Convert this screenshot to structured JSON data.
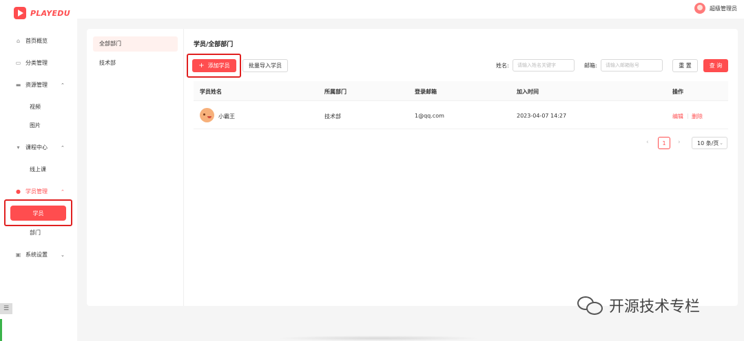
{
  "app": {
    "logo_text": "PLAYEDU"
  },
  "header": {
    "user_name": "超级管理员"
  },
  "sidebar": {
    "items": [
      {
        "label": "首页概览",
        "icon": "home-icon"
      },
      {
        "label": "分类管理",
        "icon": "category-icon"
      },
      {
        "label": "资源管理",
        "icon": "resource-icon",
        "expanded": true,
        "children": [
          "视频",
          "图片"
        ]
      },
      {
        "label": "课程中心",
        "icon": "course-icon",
        "expanded": true,
        "children": [
          "线上课"
        ]
      },
      {
        "label": "学员管理",
        "icon": "user-icon",
        "expanded": true,
        "active": true,
        "children": [
          "学员",
          "部门"
        ]
      },
      {
        "label": "系统设置",
        "icon": "settings-icon",
        "expanded": false
      }
    ]
  },
  "departments": [
    "全部部门",
    "技术部"
  ],
  "main": {
    "breadcrumb": "学员/全部部门",
    "add_button": "添加学员",
    "import_button": "批量导入学员",
    "search": {
      "name_label": "姓名:",
      "name_placeholder": "请输入姓名关键字",
      "email_label": "邮箱:",
      "email_placeholder": "请输入邮箱账号",
      "reset_label": "重 置",
      "query_label": "查 询"
    },
    "table": {
      "columns": [
        "学员姓名",
        "所属部门",
        "登录邮箱",
        "加入时间",
        "操作"
      ],
      "rows": [
        {
          "name": "小霸王",
          "department": "技术部",
          "email": "1@qq.com",
          "joined": "2023-04-07 14:27",
          "edit": "编辑",
          "delete": "删除"
        }
      ]
    },
    "pagination": {
      "prev": "‹",
      "current_page": "1",
      "next": "›",
      "page_size": "10 条/页"
    }
  },
  "watermark": {
    "text": "开源技术专栏"
  },
  "colors": {
    "accent": "#ff4d4f",
    "highlight": "#e02020"
  }
}
